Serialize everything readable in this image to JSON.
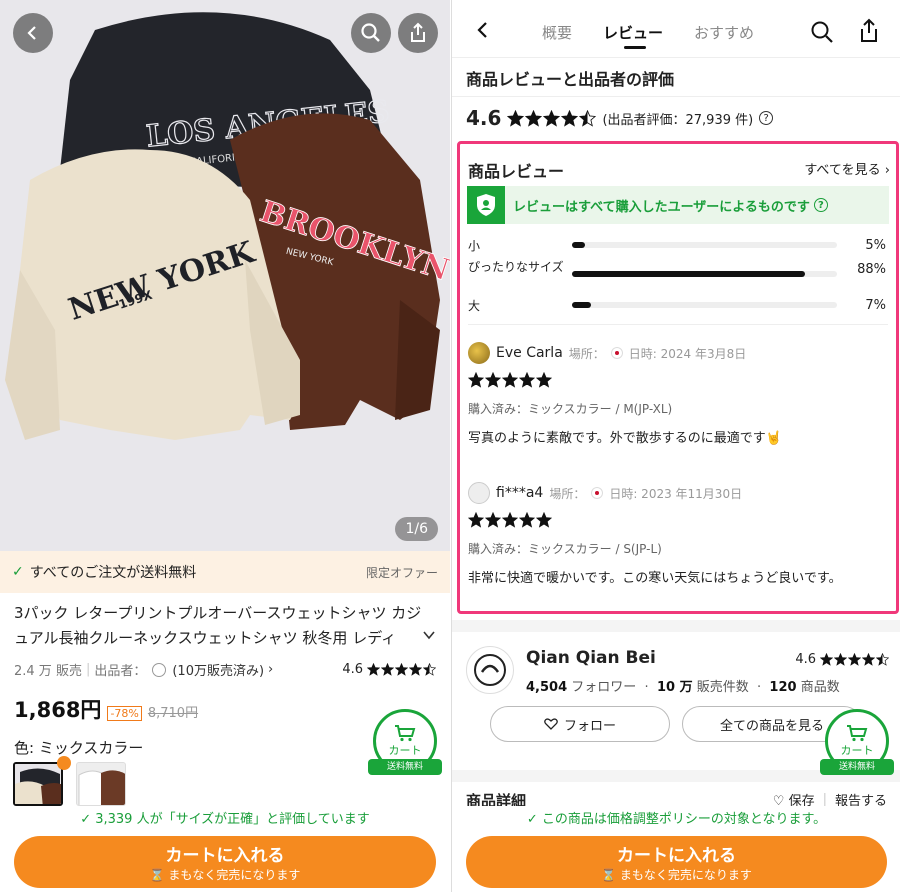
{
  "left": {
    "image_counter": "1/6",
    "sweaters": {
      "black_text": "LOS ANGELES",
      "black_sub": "CALIFORNIA",
      "cream_text": "NEW YORK",
      "cream_sub": "199X",
      "brown_text": "BROOKLYN",
      "brown_sub": "NEW YORK"
    },
    "free_shipping": "すべてのご注文が送料無料",
    "limited_offer": "限定オファー",
    "title": "3パック レタープリントプルオーバースウェットシャツ カジュアル長袖クルーネックスウェットシャツ 秋冬用 レディ",
    "sold": "2.4 万 販売",
    "seller_label": "出品者：",
    "seller_sales": "(10万販売済み)",
    "rating": "4.6",
    "price": "1,868円",
    "discount": "-78%",
    "old_price": "8,710円",
    "color_label": "色: ミックスカラー",
    "cart_label": "カート",
    "cart_free": "送料無料",
    "size_eval": "3,339 人が「サイズが正確」と評価しています",
    "add_to_cart": "カートに入れる",
    "selling_out": "まもなく完売になります"
  },
  "right": {
    "tabs": [
      "概要",
      "レビュー",
      "おすすめ"
    ],
    "section_title": "商品レビューと出品者の評価",
    "overall_score": "4.6",
    "seller_rating": "(出品者評価：27,939 件)",
    "reviews_title": "商品レビュー",
    "see_all": "すべてを見る",
    "verified_text": "レビューはすべて購入したユーザーによるものです",
    "fit": [
      {
        "label": "小",
        "pct": "5%",
        "value": 0.05
      },
      {
        "label": "ぴったりなサイズ",
        "pct": "88%",
        "value": 0.88
      },
      {
        "label": "大",
        "pct": "7%",
        "value": 0.07
      }
    ],
    "reviews": [
      {
        "name": "Eve Carla",
        "location_label": "場所：",
        "date": "日時: 2024 年3月8日",
        "bought": "購入済み：ミックスカラー / M(JP-XL)",
        "text": "写真のように素敵です。外で散歩するのに最適です🤘"
      },
      {
        "name": "fi***a4",
        "location_label": "場所：",
        "date": "日時: 2023 年11月30日",
        "bought": "購入済み：ミックスカラー / S(JP-L)",
        "text": "非常に快適で暖かいです。この寒い天気にはちょうど良いです。"
      }
    ],
    "store": {
      "name": "Qian Qian Bei",
      "rating": "4.6",
      "followers": "4,504",
      "followers_label": "フォロワー",
      "sold": "10 万",
      "sold_label": "販売件数",
      "items": "120",
      "items_label": "商品数",
      "follow": "フォロー",
      "all_items": "全ての商品を見る"
    },
    "detail_title": "商品詳細",
    "save": "保存",
    "report": "報告する",
    "cart_label": "カート",
    "cart_free": "送料無料",
    "price_policy": "この商品は価格調整ポリシーの対象となります。",
    "add_to_cart": "カートに入れる",
    "selling_out": "まもなく完売になります"
  },
  "colors": {
    "accent_orange": "#f58a1f",
    "green": "#1aa53a",
    "highlight_pink": "#f0387a"
  }
}
